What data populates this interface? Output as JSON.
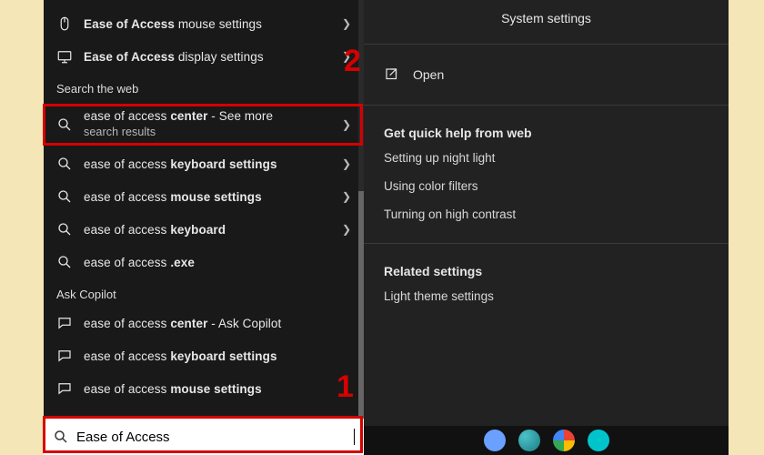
{
  "search": {
    "value": "Ease of Access"
  },
  "left": {
    "top_results": [
      {
        "prefix": "Ease of Access",
        "suffix": " mouse settings",
        "icon": "mouse"
      },
      {
        "prefix": "Ease of Access",
        "suffix": " display settings",
        "icon": "display"
      }
    ],
    "section_web": "Search the web",
    "web_results": [
      {
        "pre": "ease of access ",
        "bold": "center",
        "post": " - See more",
        "sub": "search results",
        "two": true
      },
      {
        "pre": "ease of access ",
        "bold": "keyboard settings",
        "post": "",
        "arrow": true
      },
      {
        "pre": "ease of access ",
        "bold": "mouse settings",
        "post": "",
        "arrow": true
      },
      {
        "pre": "ease of access ",
        "bold": "keyboard",
        "post": "",
        "arrow": true
      },
      {
        "pre": "ease of access ",
        "bold": ".exe",
        "post": ""
      }
    ],
    "section_copilot": "Ask Copilot",
    "copilot_results": [
      {
        "pre": "ease of access ",
        "bold": "center",
        "post": " - Ask Copilot"
      },
      {
        "pre": "ease of access ",
        "bold": "keyboard settings",
        "post": ""
      },
      {
        "pre": "ease of access ",
        "bold": "mouse settings",
        "post": ""
      }
    ]
  },
  "right": {
    "title": "System settings",
    "open": "Open",
    "help_head": "Get quick help from web",
    "help_links": [
      "Setting up night light",
      "Using color filters",
      "Turning on high contrast"
    ],
    "related_head": "Related settings",
    "related_links": [
      "Light theme settings"
    ]
  },
  "annotations": {
    "n1": "1",
    "n2": "2"
  }
}
